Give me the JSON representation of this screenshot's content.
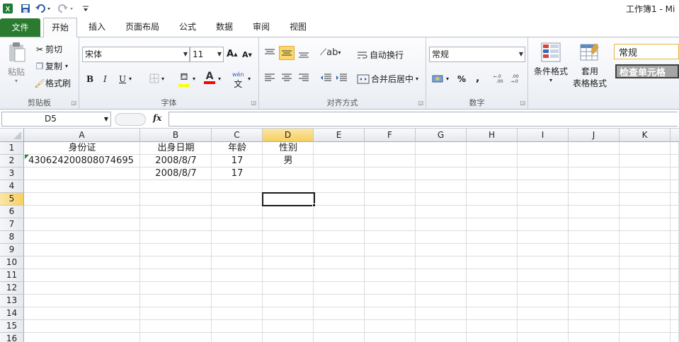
{
  "window": {
    "title": "工作簿1 - Mi",
    "quick_access": [
      "save-icon",
      "undo-icon",
      "redo-icon",
      "customize-icon"
    ]
  },
  "tabs": [
    "文件",
    "开始",
    "插入",
    "页面布局",
    "公式",
    "数据",
    "审阅",
    "视图"
  ],
  "ribbon": {
    "clipboard": {
      "label": "剪贴板",
      "paste": "粘贴",
      "cut": "剪切",
      "copy": "复制",
      "format_painter": "格式刷"
    },
    "font": {
      "label": "字体",
      "family": "宋体",
      "size": "11",
      "bold": "B",
      "italic": "I",
      "underline": "U"
    },
    "alignment": {
      "label": "对齐方式",
      "wrap_text": "自动换行",
      "merge_center": "合并后居中"
    },
    "number": {
      "label": "数字",
      "format": "常规",
      "percent": "%",
      "comma": ","
    },
    "styles": {
      "conditional_formatting": "条件格式",
      "format_as_table_1": "套用",
      "format_as_table_2": "表格格式",
      "style_normal": "常规",
      "style_check_cell": "检查单元格"
    }
  },
  "formula_bar": {
    "name_box": "D5",
    "fx": "fx",
    "value": ""
  },
  "sheet": {
    "columns": [
      "A",
      "B",
      "C",
      "D",
      "E",
      "F",
      "G",
      "H",
      "I",
      "J",
      "K"
    ],
    "rows": [
      "1",
      "2",
      "3",
      "4",
      "5",
      "6",
      "7",
      "8",
      "9",
      "10",
      "11",
      "12",
      "13",
      "14",
      "15",
      "16"
    ],
    "selected_cell": "D5",
    "cells": {
      "A1": "身份证",
      "B1": "出身日期",
      "C1": "年龄",
      "D1": "性别",
      "A2": "430624200808074695",
      "B2": "2008/8/7",
      "C2": "17",
      "D2": "男",
      "B3": "2008/8/7",
      "C3": "17"
    }
  },
  "colors": {
    "file_tab": "#2a7a2f",
    "selection_header": "#f7cf5e",
    "style_check_cell_bg": "#a5a5a5"
  }
}
